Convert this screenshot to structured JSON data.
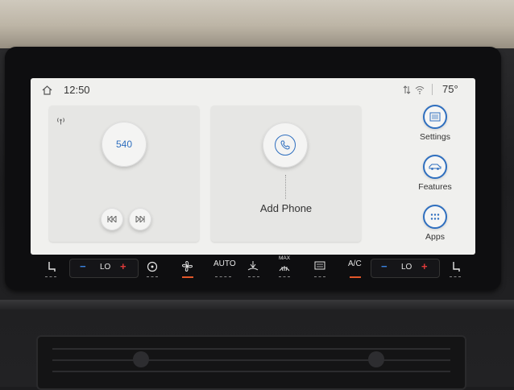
{
  "status_bar": {
    "time": "12:50",
    "temperature": "75°"
  },
  "radio": {
    "station": "540",
    "prev_icon": "skip-back-icon",
    "next_icon": "skip-forward-icon"
  },
  "phone": {
    "add_phone_label": "Add Phone"
  },
  "side_menu": [
    {
      "label": "Settings",
      "icon": "settings-icon"
    },
    {
      "label": "Features",
      "icon": "vehicle-icon"
    },
    {
      "label": "Apps",
      "icon": "apps-grid-icon"
    }
  ],
  "climate": {
    "left_temp": "LO",
    "right_temp": "LO",
    "auto_label": "AUTO",
    "max_label": "MAX",
    "ac_label": "A/C",
    "minus": "−",
    "plus": "+"
  },
  "colors": {
    "accent": "#2f6fbf",
    "screen_bg": "#f0f0ee",
    "active_indicator": "#e2572a"
  }
}
